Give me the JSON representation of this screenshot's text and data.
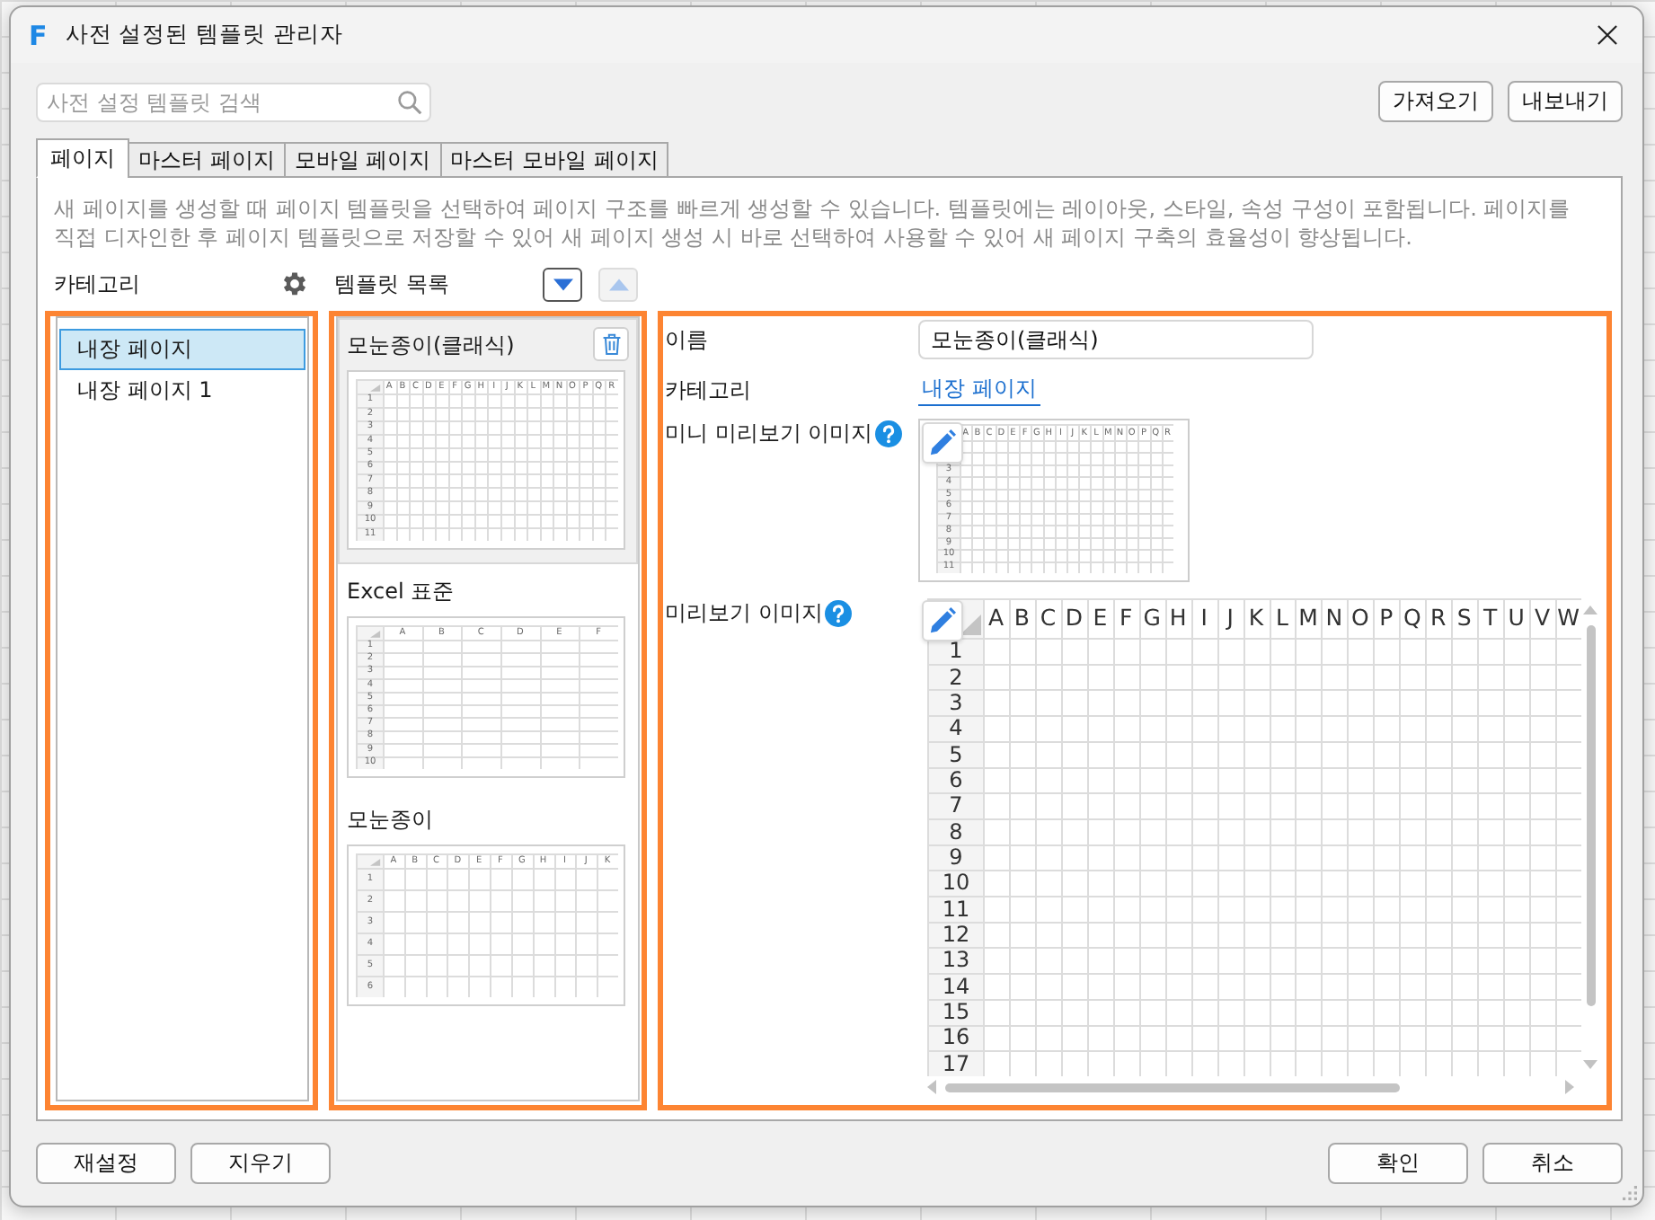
{
  "window": {
    "logo": "F",
    "title": "사전 설정된 템플릿 관리자"
  },
  "search": {
    "placeholder": "사전 설정 템플릿 검색"
  },
  "toolbar_buttons": [
    "가져오기",
    "내보내기"
  ],
  "tabs": [
    {
      "label": "페이지",
      "selected": true
    },
    {
      "label": "마스터 페이지",
      "selected": false
    },
    {
      "label": "모바일 페이지",
      "selected": false
    },
    {
      "label": "마스터 모바일 페이지",
      "selected": false
    }
  ],
  "description": "새 페이지를 생성할 때 페이지 템플릿을 선택하여 페이지 구조를 빠르게 생성할 수 있습니다. 템플릿에는 레이아웃, 스타일, 속성 구성이 포함됩니다. 페이지를 직접 디자인한 후 페이지 템플릿으로 저장할 수 있어 새 페이지 생성 시 바로 선택하여 사용할 수 있어 새 페이지 구축의 효율성이 향상됩니다.",
  "category_panel": {
    "title": "카테고리",
    "highlighted": true,
    "items": [
      {
        "label": "내장 페이지",
        "selected": true
      },
      {
        "label": "내장 페이지 1",
        "selected": false
      }
    ]
  },
  "template_panel": {
    "title": "템플릿 목록",
    "highlighted": true,
    "sort_buttons": [
      {
        "kind": "down",
        "disabled": false
      },
      {
        "kind": "up",
        "disabled": true
      }
    ],
    "items": [
      {
        "name": "모눈종이(클래식)",
        "selected": true,
        "preview": {
          "columns": [
            "A",
            "B",
            "C",
            "D",
            "E",
            "F",
            "G",
            "H",
            "I",
            "J",
            "K",
            "L",
            "M",
            "N",
            "O",
            "P",
            "Q",
            "R"
          ],
          "rows": [
            "1",
            "2",
            "3",
            "4",
            "5",
            "6",
            "7",
            "8",
            "9",
            "10",
            "11"
          ]
        }
      },
      {
        "name": "Excel 표준",
        "selected": false,
        "preview": {
          "columns": [
            "A",
            "B",
            "C",
            "D",
            "E",
            "F"
          ],
          "rows": [
            "1",
            "2",
            "3",
            "4",
            "5",
            "6",
            "7",
            "8",
            "9",
            "10"
          ]
        }
      },
      {
        "name": "모눈종이",
        "selected": false,
        "preview": {
          "columns": [
            "A",
            "B",
            "C",
            "D",
            "E",
            "F",
            "G",
            "H",
            "I",
            "J",
            "K"
          ],
          "rows": [
            "1",
            "2",
            "3",
            "4",
            "5",
            "6"
          ]
        }
      }
    ]
  },
  "details_panel": {
    "highlighted": true,
    "name": {
      "label": "이름",
      "value": "모눈종이(클래식)"
    },
    "category": {
      "label": "카테고리",
      "link": "내장 페이지"
    },
    "mini_preview": {
      "label": "미니 미리보기 이미지",
      "columns": [
        "A",
        "B",
        "C",
        "D",
        "E",
        "F",
        "G",
        "H",
        "I",
        "J",
        "K",
        "L",
        "M",
        "N",
        "O",
        "P",
        "Q",
        "R"
      ],
      "rows": [
        "3",
        "4",
        "5",
        "6",
        "7",
        "8",
        "9",
        "10",
        "11"
      ]
    },
    "preview": {
      "label": "미리보기 이미지",
      "columns": [
        "A",
        "B",
        "C",
        "D",
        "E",
        "F",
        "G",
        "H",
        "I",
        "J",
        "K",
        "L",
        "M",
        "N",
        "O",
        "P",
        "Q",
        "R",
        "S",
        "T",
        "U",
        "V",
        "W"
      ],
      "rows": [
        "1",
        "2",
        "3",
        "4",
        "5",
        "6",
        "7",
        "8",
        "9",
        "10",
        "11",
        "12",
        "13",
        "14",
        "15",
        "16",
        "17"
      ]
    }
  },
  "footer_buttons": {
    "left": [
      "재설정",
      "지우기"
    ],
    "right": [
      "확인",
      "취소"
    ]
  }
}
